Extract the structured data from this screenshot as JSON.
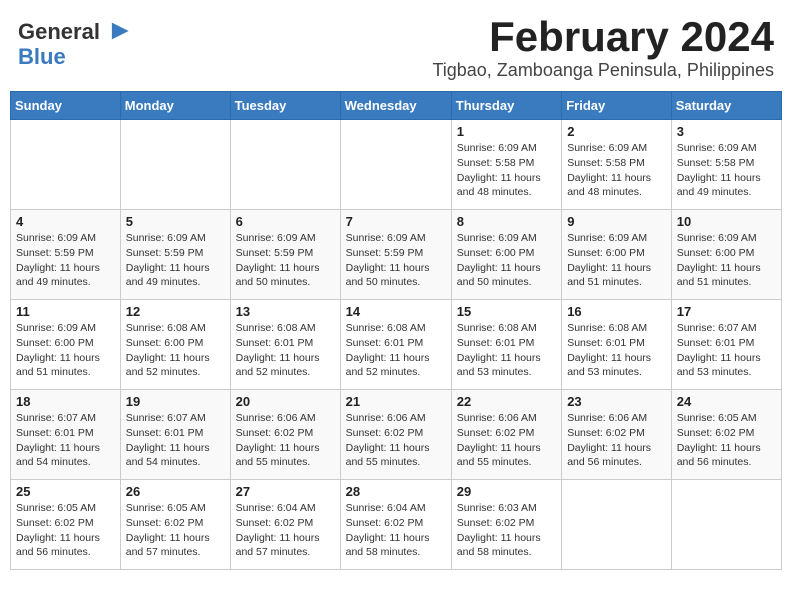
{
  "header": {
    "logo_general": "General",
    "logo_blue": "Blue",
    "month_title": "February 2024",
    "location": "Tigbao, Zamboanga Peninsula, Philippines"
  },
  "weekdays": [
    "Sunday",
    "Monday",
    "Tuesday",
    "Wednesday",
    "Thursday",
    "Friday",
    "Saturday"
  ],
  "weeks": [
    [
      {
        "day": "",
        "info": ""
      },
      {
        "day": "",
        "info": ""
      },
      {
        "day": "",
        "info": ""
      },
      {
        "day": "",
        "info": ""
      },
      {
        "day": "1",
        "info": "Sunrise: 6:09 AM\nSunset: 5:58 PM\nDaylight: 11 hours\nand 48 minutes."
      },
      {
        "day": "2",
        "info": "Sunrise: 6:09 AM\nSunset: 5:58 PM\nDaylight: 11 hours\nand 48 minutes."
      },
      {
        "day": "3",
        "info": "Sunrise: 6:09 AM\nSunset: 5:58 PM\nDaylight: 11 hours\nand 49 minutes."
      }
    ],
    [
      {
        "day": "4",
        "info": "Sunrise: 6:09 AM\nSunset: 5:59 PM\nDaylight: 11 hours\nand 49 minutes."
      },
      {
        "day": "5",
        "info": "Sunrise: 6:09 AM\nSunset: 5:59 PM\nDaylight: 11 hours\nand 49 minutes."
      },
      {
        "day": "6",
        "info": "Sunrise: 6:09 AM\nSunset: 5:59 PM\nDaylight: 11 hours\nand 50 minutes."
      },
      {
        "day": "7",
        "info": "Sunrise: 6:09 AM\nSunset: 5:59 PM\nDaylight: 11 hours\nand 50 minutes."
      },
      {
        "day": "8",
        "info": "Sunrise: 6:09 AM\nSunset: 6:00 PM\nDaylight: 11 hours\nand 50 minutes."
      },
      {
        "day": "9",
        "info": "Sunrise: 6:09 AM\nSunset: 6:00 PM\nDaylight: 11 hours\nand 51 minutes."
      },
      {
        "day": "10",
        "info": "Sunrise: 6:09 AM\nSunset: 6:00 PM\nDaylight: 11 hours\nand 51 minutes."
      }
    ],
    [
      {
        "day": "11",
        "info": "Sunrise: 6:09 AM\nSunset: 6:00 PM\nDaylight: 11 hours\nand 51 minutes."
      },
      {
        "day": "12",
        "info": "Sunrise: 6:08 AM\nSunset: 6:00 PM\nDaylight: 11 hours\nand 52 minutes."
      },
      {
        "day": "13",
        "info": "Sunrise: 6:08 AM\nSunset: 6:01 PM\nDaylight: 11 hours\nand 52 minutes."
      },
      {
        "day": "14",
        "info": "Sunrise: 6:08 AM\nSunset: 6:01 PM\nDaylight: 11 hours\nand 52 minutes."
      },
      {
        "day": "15",
        "info": "Sunrise: 6:08 AM\nSunset: 6:01 PM\nDaylight: 11 hours\nand 53 minutes."
      },
      {
        "day": "16",
        "info": "Sunrise: 6:08 AM\nSunset: 6:01 PM\nDaylight: 11 hours\nand 53 minutes."
      },
      {
        "day": "17",
        "info": "Sunrise: 6:07 AM\nSunset: 6:01 PM\nDaylight: 11 hours\nand 53 minutes."
      }
    ],
    [
      {
        "day": "18",
        "info": "Sunrise: 6:07 AM\nSunset: 6:01 PM\nDaylight: 11 hours\nand 54 minutes."
      },
      {
        "day": "19",
        "info": "Sunrise: 6:07 AM\nSunset: 6:01 PM\nDaylight: 11 hours\nand 54 minutes."
      },
      {
        "day": "20",
        "info": "Sunrise: 6:06 AM\nSunset: 6:02 PM\nDaylight: 11 hours\nand 55 minutes."
      },
      {
        "day": "21",
        "info": "Sunrise: 6:06 AM\nSunset: 6:02 PM\nDaylight: 11 hours\nand 55 minutes."
      },
      {
        "day": "22",
        "info": "Sunrise: 6:06 AM\nSunset: 6:02 PM\nDaylight: 11 hours\nand 55 minutes."
      },
      {
        "day": "23",
        "info": "Sunrise: 6:06 AM\nSunset: 6:02 PM\nDaylight: 11 hours\nand 56 minutes."
      },
      {
        "day": "24",
        "info": "Sunrise: 6:05 AM\nSunset: 6:02 PM\nDaylight: 11 hours\nand 56 minutes."
      }
    ],
    [
      {
        "day": "25",
        "info": "Sunrise: 6:05 AM\nSunset: 6:02 PM\nDaylight: 11 hours\nand 56 minutes."
      },
      {
        "day": "26",
        "info": "Sunrise: 6:05 AM\nSunset: 6:02 PM\nDaylight: 11 hours\nand 57 minutes."
      },
      {
        "day": "27",
        "info": "Sunrise: 6:04 AM\nSunset: 6:02 PM\nDaylight: 11 hours\nand 57 minutes."
      },
      {
        "day": "28",
        "info": "Sunrise: 6:04 AM\nSunset: 6:02 PM\nDaylight: 11 hours\nand 58 minutes."
      },
      {
        "day": "29",
        "info": "Sunrise: 6:03 AM\nSunset: 6:02 PM\nDaylight: 11 hours\nand 58 minutes."
      },
      {
        "day": "",
        "info": ""
      },
      {
        "day": "",
        "info": ""
      }
    ]
  ]
}
